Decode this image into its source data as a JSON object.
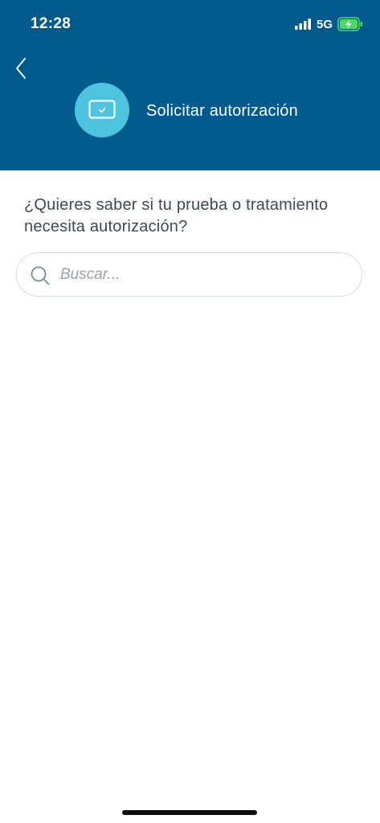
{
  "status_bar": {
    "time": "12:28",
    "network": "5G"
  },
  "header": {
    "title": "Solicitar autorización",
    "avatar_icon": "card-check-icon",
    "back_icon": "chevron-left-icon"
  },
  "main": {
    "question": "¿Quieres saber si tu prueba o tratamiento necesita autorización?",
    "search": {
      "placeholder": "Buscar...",
      "value": "",
      "icon": "search-icon"
    }
  },
  "colors": {
    "header_bg": "#005b8c",
    "avatar_bg": "#4ec3df",
    "text": "#3b4a5a",
    "battery_charging": "#4cd964"
  }
}
